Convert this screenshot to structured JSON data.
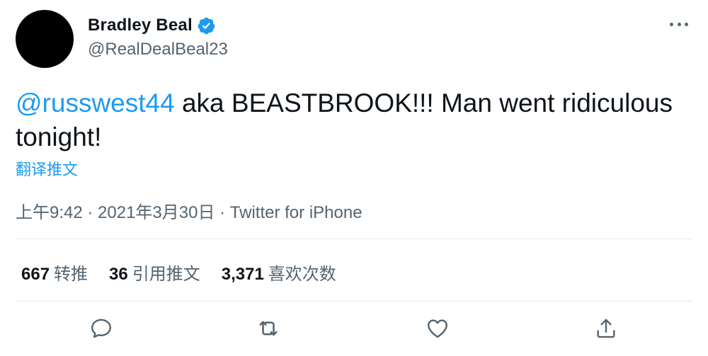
{
  "author": {
    "display_name": "Bradley Beal",
    "handle": "@RealDealBeal23",
    "verified": true
  },
  "tweet": {
    "mention": "@russwest44",
    "text_after_mention": " aka BEASTBROOK!!! Man went ridiculous tonight!",
    "translate_link": "翻译推文",
    "meta": "上午9:42 · 2021年3月30日 · Twitter for iPhone"
  },
  "stats": {
    "retweets_count": "667",
    "retweets_label": "转推",
    "quotes_count": "36",
    "quotes_label": "引用推文",
    "likes_count": "3,371",
    "likes_label": "喜欢次数"
  },
  "actions": [
    "reply-icon",
    "retweet-icon",
    "like-icon",
    "share-icon"
  ],
  "colors": {
    "accent": "#1d9bf0",
    "text": "#0f1419",
    "secondary": "#536471",
    "divider": "#e3e7ea"
  }
}
